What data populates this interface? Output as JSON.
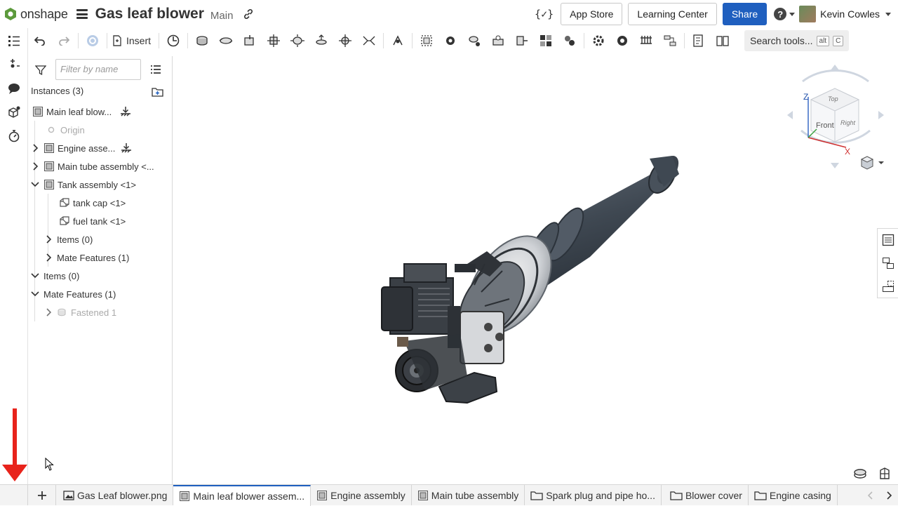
{
  "app": {
    "logo_text": "onshape",
    "doc_title": "Gas leaf blower",
    "branch": "Main"
  },
  "header": {
    "app_store": "App Store",
    "learning_center": "Learning Center",
    "share": "Share",
    "help": "?",
    "user_name": "Kevin Cowles",
    "variable_icon": "{✓}"
  },
  "toolbar": {
    "insert": "Insert",
    "search_tools": "Search tools...",
    "shortcut_1": "alt",
    "shortcut_2": "C"
  },
  "panel": {
    "filter_placeholder": "Filter by name",
    "instances_label": "Instances (3)",
    "tree": [
      {
        "label": "Main leaf blow..."
      },
      {
        "label": "Origin"
      },
      {
        "label": "Engine asse..."
      },
      {
        "label": "Main tube assembly <..."
      },
      {
        "label": "Tank assembly <1>"
      },
      {
        "label": "tank cap <1>"
      },
      {
        "label": "fuel tank <1>"
      },
      {
        "label": "Items (0)"
      },
      {
        "label": "Mate Features (1)"
      },
      {
        "label": "Items (0)"
      },
      {
        "label": "Mate Features (1)"
      },
      {
        "label": "Fastened 1"
      }
    ]
  },
  "viewcube": {
    "z": "Z",
    "x": "X",
    "top": "Top",
    "front": "Front",
    "right": "Right"
  },
  "tabs": [
    {
      "label": "Gas Leaf blower.png"
    },
    {
      "label": "Main leaf blower assem..."
    },
    {
      "label": "Engine assembly"
    },
    {
      "label": "Main tube assembly"
    },
    {
      "label": "Spark plug and pipe ho..."
    },
    {
      "label": "Blower cover"
    },
    {
      "label": "Engine casing"
    }
  ],
  "colors": {
    "accent": "#1f5fbf",
    "arrow": "#e8231b",
    "model": "#3f4852"
  }
}
